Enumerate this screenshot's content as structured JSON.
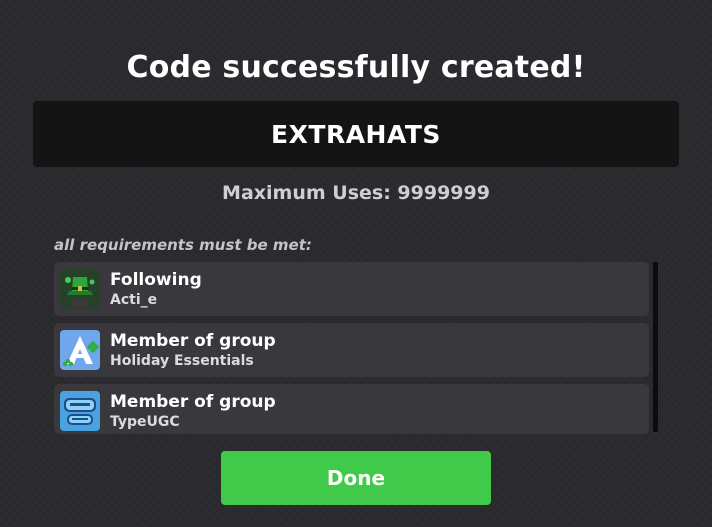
{
  "dialog": {
    "title": "Code successfully created!",
    "code": "EXTRAHATS",
    "max_uses_text": "Maximum Uses: 9999999",
    "requirements_label": "all requirements must be met:"
  },
  "requirements": [
    {
      "title": "Following",
      "subtitle": "Acti_e",
      "icon": "hat-avatar-icon"
    },
    {
      "title": "Member of group",
      "subtitle": "Holiday Essentials",
      "icon": "group-logo-holiday-essentials-icon"
    },
    {
      "title": "Member of group",
      "subtitle": "TypeUGC",
      "icon": "group-logo-typeugc-icon"
    }
  ],
  "done_button": {
    "label": "Done"
  },
  "colors": {
    "background": "#2b2b2f",
    "code_box": "#141414",
    "row": "#38383d",
    "done": "#41c94a"
  }
}
